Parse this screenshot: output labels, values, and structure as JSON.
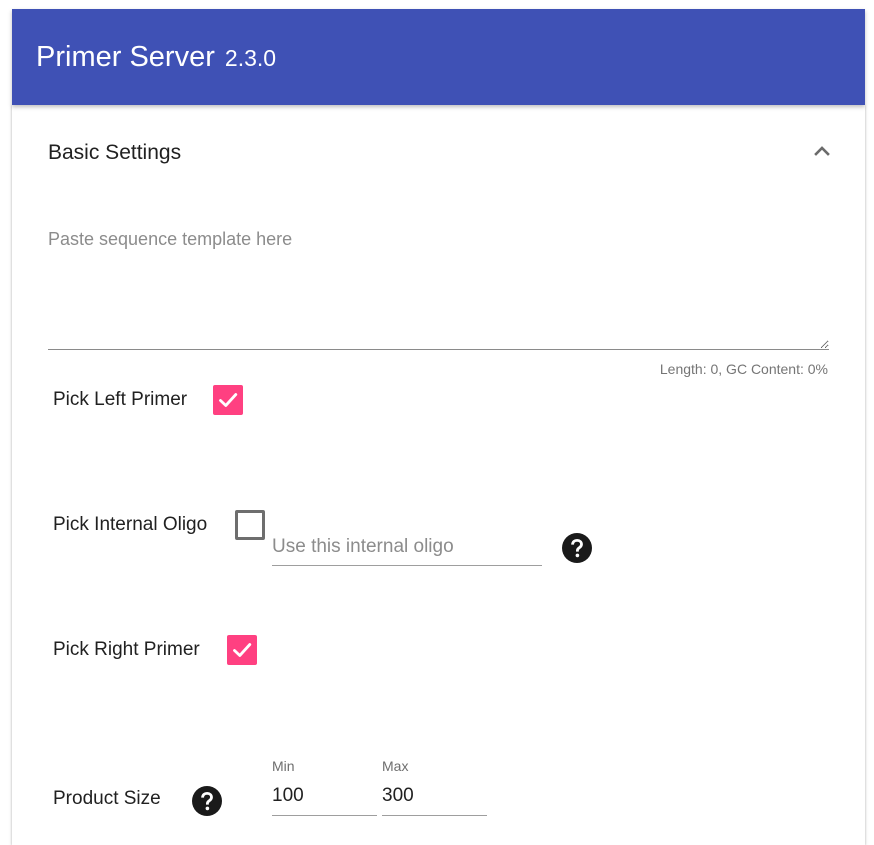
{
  "app": {
    "title": "Primer Server",
    "version": "2.3.0",
    "bar_color": "#3f51b5"
  },
  "panel": {
    "title": "Basic Settings",
    "expand_icon": "chevron-up-icon",
    "expanded": true
  },
  "sequence": {
    "value": "",
    "placeholder": "Paste sequence template here",
    "stats": "Length: 0, GC Content: 0%"
  },
  "pick_left_primer": {
    "label": "Pick Left Primer",
    "checked": true
  },
  "pick_internal_oligo": {
    "label": "Pick Internal Oligo",
    "checked": false,
    "oligo_input": {
      "value": "",
      "placeholder": "Use this internal oligo"
    },
    "help_icon": "help-circle-icon"
  },
  "pick_right_primer": {
    "label": "Pick Right Primer",
    "checked": true
  },
  "product_size": {
    "label": "Product Size",
    "help_icon": "help-circle-icon",
    "min_label": "Min",
    "min_value": "100",
    "max_label": "Max",
    "max_value": "300"
  },
  "colors": {
    "accent": "#ff4081",
    "primary": "#3f51b5"
  }
}
